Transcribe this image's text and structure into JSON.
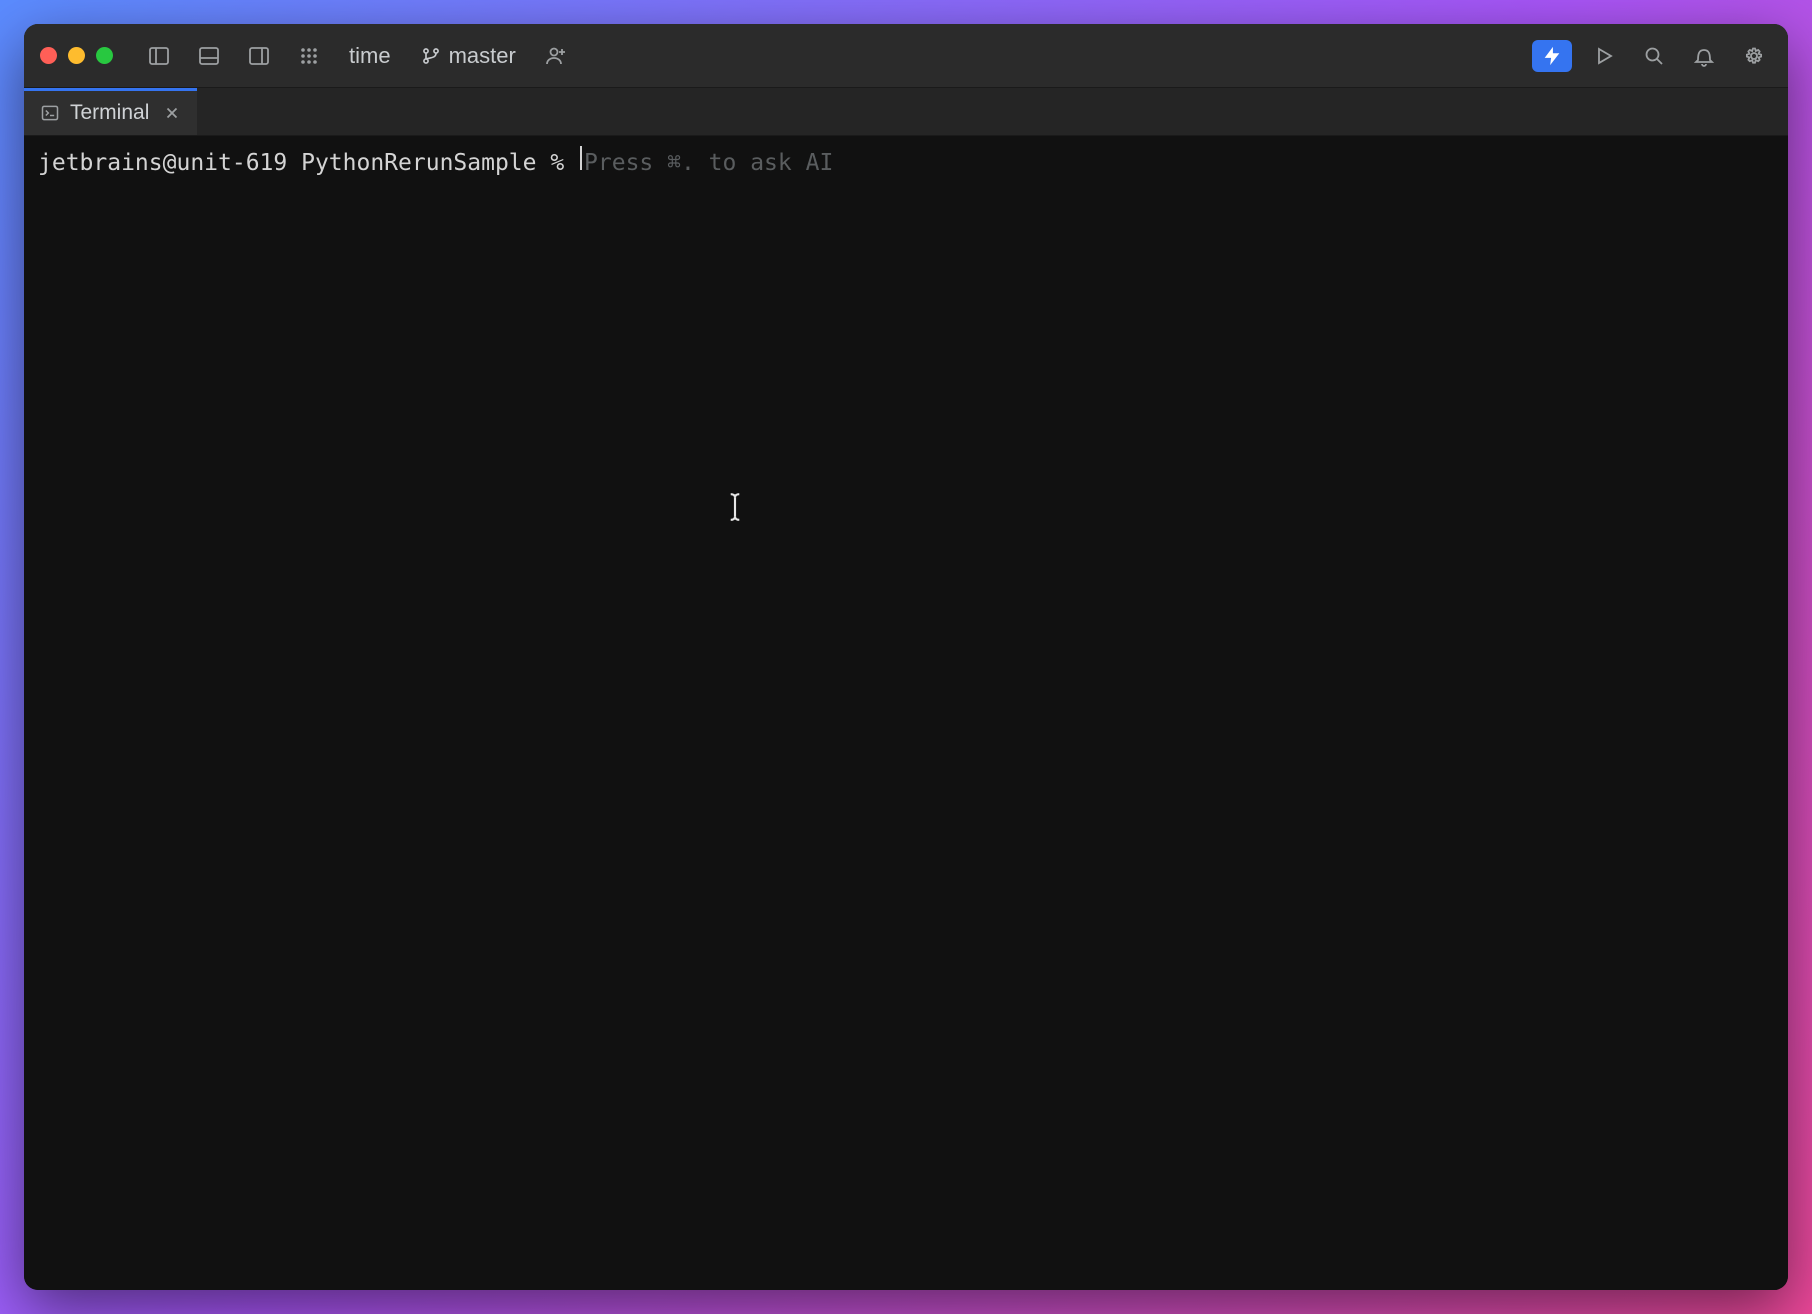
{
  "toolbar": {
    "project_label": "time",
    "branch_label": "master"
  },
  "tabs": [
    {
      "label": "Terminal"
    }
  ],
  "terminal": {
    "prompt": "jetbrains@unit-619 PythonRerunSample % ",
    "ghost_hint": "Press ⌘. to ask AI"
  },
  "icons": {
    "close": "close-icon",
    "minimize": "minimize-icon",
    "maximize": "maximize-icon",
    "left_panel": "left-panel-icon",
    "bottom_panel": "bottom-panel-icon",
    "right_panel": "right-panel-icon",
    "grid": "grid-icon",
    "branch": "branch-icon",
    "add_person": "add-person-icon",
    "ai": "ai-bolt-icon",
    "run": "run-icon",
    "search": "search-icon",
    "bell": "bell-icon",
    "gear": "gear-icon",
    "terminal": "terminal-icon",
    "tab_close": "tab-close-icon"
  },
  "colors": {
    "accent": "#3574f0",
    "window_bg": "#1a1a1a",
    "titlebar_bg": "#2b2b2b",
    "terminal_bg": "#111111",
    "traffic_red": "#ff5f57",
    "traffic_yellow": "#febc2e",
    "traffic_green": "#28c840"
  }
}
